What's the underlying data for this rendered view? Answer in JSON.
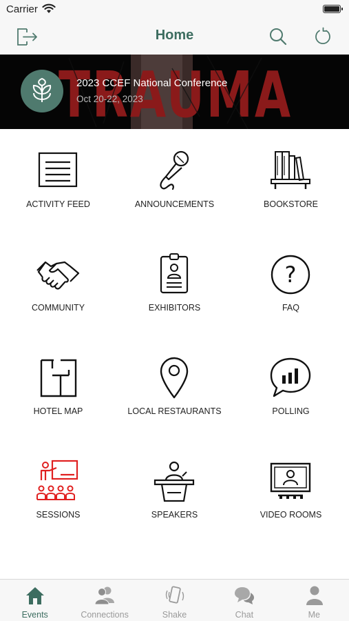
{
  "status_bar": {
    "carrier": "Carrier"
  },
  "nav": {
    "title": "Home"
  },
  "banner": {
    "title": "2023 CCEF National Conference",
    "dates": "Oct 20-22, 2023",
    "background_text": "TRAUMA"
  },
  "grid": {
    "items": [
      {
        "label": "ACTIVITY FEED",
        "icon": "activity-feed-icon"
      },
      {
        "label": "ANNOUNCEMENTS",
        "icon": "microphone-icon"
      },
      {
        "label": "BOOKSTORE",
        "icon": "bookshelf-icon"
      },
      {
        "label": "COMMUNITY",
        "icon": "handshake-icon"
      },
      {
        "label": "EXHIBITORS",
        "icon": "id-badge-icon"
      },
      {
        "label": "FAQ",
        "icon": "question-mark-icon"
      },
      {
        "label": "HOTEL MAP",
        "icon": "floor-plan-icon"
      },
      {
        "label": "LOCAL RESTAURANTS",
        "icon": "map-pin-icon"
      },
      {
        "label": "POLLING",
        "icon": "poll-chat-icon"
      },
      {
        "label": "SESSIONS",
        "icon": "presentation-audience-icon"
      },
      {
        "label": "SPEAKERS",
        "icon": "podium-speaker-icon"
      },
      {
        "label": "VIDEO ROOMS",
        "icon": "video-room-icon"
      }
    ]
  },
  "tab_bar": {
    "tabs": [
      {
        "label": "Events",
        "icon": "house-icon",
        "active": true
      },
      {
        "label": "Connections",
        "icon": "people-icon",
        "active": false
      },
      {
        "label": "Shake",
        "icon": "shake-phone-icon",
        "active": false
      },
      {
        "label": "Chat",
        "icon": "chat-bubbles-icon",
        "active": false
      },
      {
        "label": "Me",
        "icon": "person-icon",
        "active": false
      }
    ]
  },
  "colors": {
    "accent": "#3d6d60",
    "logo_circle": "#4f7a6e",
    "sessions_icon": "#e02020",
    "banner_text_red": "#8a1a1a",
    "inactive_tab": "#9a9a9a"
  }
}
